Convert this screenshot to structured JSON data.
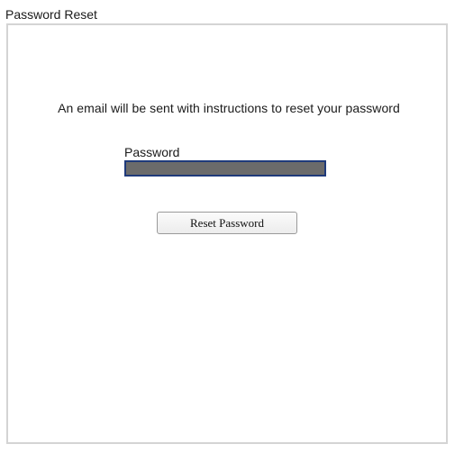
{
  "page": {
    "title": "Password Reset"
  },
  "form": {
    "instructions": "An email will be sent with instructions to reset your password",
    "password_label": "Password",
    "password_value": "",
    "submit_label": "Reset Password"
  },
  "colors": {
    "input_background": "#6b6b6b",
    "input_border": "#1f3a7a",
    "panel_border": "#d4d4d4"
  }
}
